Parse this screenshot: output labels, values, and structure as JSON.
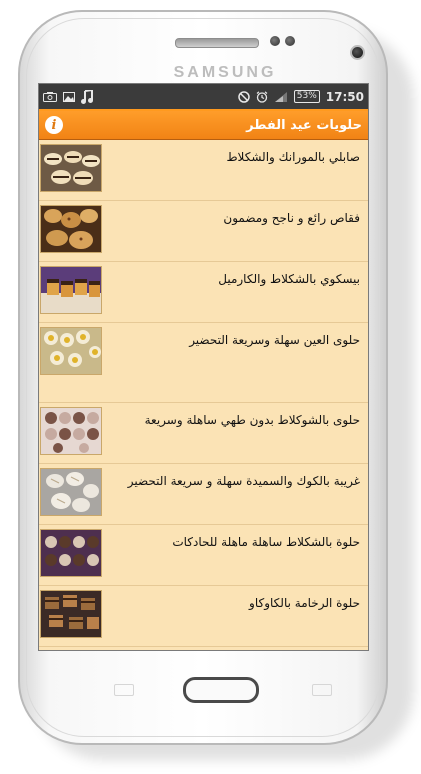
{
  "device": {
    "brand": "SAMSUNG"
  },
  "status_bar": {
    "icons_left": [
      "screenshot-icon",
      "image-icon",
      "music-icon"
    ],
    "icons_right": [
      "do-not-disturb-icon",
      "alarm-icon",
      "signal-icon"
    ],
    "battery": "53%",
    "time": "17:50"
  },
  "app_bar": {
    "title": "حلويات عيد الفطر",
    "info_label": "i",
    "colors": {
      "bar": "#f18315",
      "background": "#fbe3b5"
    }
  },
  "recipes": [
    {
      "title": "صابلي بالمورانك والشكلاط",
      "thumbnail": "chocolate-stripe-cookies-thumbnail"
    },
    {
      "title": "فقاص رائع و ناجح ومضمون",
      "thumbnail": "fekkas-biscuits-thumbnail"
    },
    {
      "title": "بيسكوي بالشكلاط والكارميل",
      "thumbnail": "caramel-chocolate-biscuits-thumbnail"
    },
    {
      "title": "حلوى العين سهلة وسريعة التحضير",
      "thumbnail": "eye-cookies-thumbnail"
    },
    {
      "title": "حلوى بالشوكلاط بدون طهي ساهلة وسريعة",
      "thumbnail": "no-bake-chocolate-sweets-thumbnail"
    },
    {
      "title": "غريبة بالكوك والسميدة سهلة و سريعة التحضير",
      "thumbnail": "coconut-semolina-ghriba-thumbnail"
    },
    {
      "title": "حلوة بالشكلاط ساهلة ماهلة للحادكات",
      "thumbnail": "easy-chocolate-sweets-thumbnail"
    },
    {
      "title": "حلوة الرخامة بالكاوكاو",
      "thumbnail": "marble-peanut-sweets-thumbnail"
    }
  ]
}
